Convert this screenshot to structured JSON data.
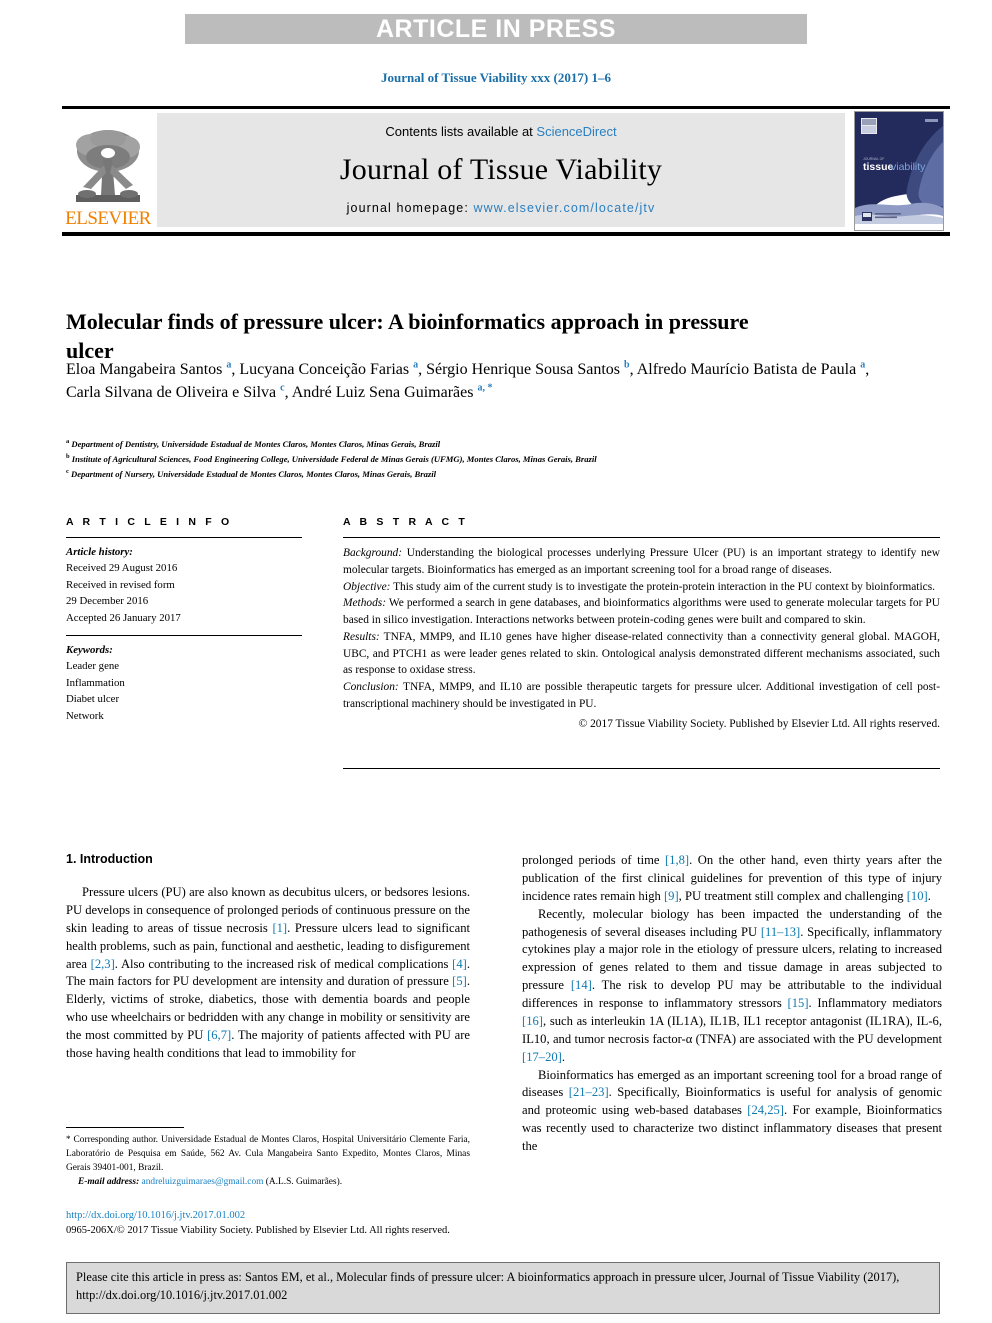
{
  "banner": {
    "text": "ARTICLE IN PRESS",
    "bg_color": "#bcbcbc",
    "text_color": "#ffffff"
  },
  "running_head": "Journal of Tissue Viability xxx (2017) 1–6",
  "masthead": {
    "publisher_logo_name": "elsevier-tree-logo",
    "publisher_wordmark": "ELSEVIER",
    "contents_prefix": "Contents lists available at ",
    "contents_link": "ScienceDirect",
    "journal_name": "Journal of Tissue Viability",
    "homepage_label": "journal homepage: ",
    "homepage_url": "www.elsevier.com/locate/jtv",
    "cover_title_a": "tissue",
    "cover_title_b": "viability",
    "accent_blue": "#2a7fc0",
    "elsevier_orange": "#f08000",
    "cover_navy": "#1f2352"
  },
  "article": {
    "title": "Molecular finds of pressure ulcer: A bioinformatics approach in pressure ulcer",
    "authors": [
      {
        "name": "Eloa Mangabeira Santos",
        "sup": "a",
        "sep": ", "
      },
      {
        "name": "Lucyana Conceição Farias",
        "sup": "a",
        "sep": ", "
      },
      {
        "name": "Sérgio Henrique Sousa Santos",
        "sup": "b",
        "sep": ", "
      },
      {
        "name": "Alfredo Maurício Batista de Paula",
        "sup": "a",
        "sep": ", "
      },
      {
        "name": "Carla Silvana de Oliveira e Silva",
        "sup": "c",
        "sep": ", "
      },
      {
        "name": "André Luiz Sena Guimarães",
        "sup": "a, *",
        "sep": ""
      }
    ],
    "affiliations": [
      {
        "mark": "a",
        "text": "Department of Dentistry, Universidade Estadual de Montes Claros, Montes Claros, Minas Gerais, Brazil"
      },
      {
        "mark": "b",
        "text": "Institute of Agricultural Sciences, Food Engineering College, Universidade Federal de Minas Gerais (UFMG), Montes Claros, Minas Gerais, Brazil"
      },
      {
        "mark": "c",
        "text": "Department of Nursery, Universidade Estadual de Montes Claros, Montes Claros, Minas Gerais, Brazil"
      }
    ]
  },
  "article_info": {
    "heading": "A R T I C L E   I N F O",
    "history_label": "Article history:",
    "history": [
      "Received 29 August 2016",
      "Received in revised form",
      "29 December 2016",
      "Accepted 26 January 2017"
    ],
    "keywords_label": "Keywords:",
    "keywords": [
      "Leader gene",
      "Inflammation",
      "Diabet ulcer",
      "Network"
    ]
  },
  "abstract": {
    "heading": "A B S T R A C T",
    "sections": [
      {
        "label": "Background:",
        "text": " Understanding the biological processes underlying Pressure Ulcer (PU) is an important strategy to identify new molecular targets. Bioinformatics has emerged as an important screening tool for a broad range of diseases."
      },
      {
        "label": "Objective:",
        "text": " This study aim of the current study is to investigate the protein-protein interaction in the PU context by bioinformatics."
      },
      {
        "label": "Methods:",
        "text": " We performed a search in gene databases, and bioinformatics algorithms were used to generate molecular targets for PU based in silico investigation. Interactions networks between protein-coding genes were built and compared to skin."
      },
      {
        "label": "Results:",
        "text": " TNFA, MMP9, and IL10 genes have higher disease-related connectivity than a connectivity general global. MAGOH, UBC, and PTCH1 as were leader genes related to skin. Ontological analysis demonstrated different mechanisms associated, such as response to oxidase stress."
      },
      {
        "label": "Conclusion:",
        "text": " TNFA, MMP9, and IL10 are possible therapeutic targets for pressure ulcer. Additional investigation of cell post-transcriptional machinery should be investigated in PU."
      }
    ],
    "copyright": "© 2017 Tissue Viability Society. Published by Elsevier Ltd. All rights reserved."
  },
  "body": {
    "section_number_title": "1. Introduction",
    "left_paragraphs": [
      {
        "parts": [
          {
            "t": "Pressure ulcers (PU) are also known as decubitus ulcers, or bedsores lesions. PU develops in consequence of prolonged periods of continuous pressure on the skin leading to areas of tissue necrosis ",
            "r": false
          },
          {
            "t": "[1]",
            "r": true
          },
          {
            "t": ". Pressure ulcers lead to significant health problems, such as pain, functional and aesthetic, leading to disfigurement area ",
            "r": false
          },
          {
            "t": "[2,3]",
            "r": true
          },
          {
            "t": ". Also contributing to the increased risk of medical complications ",
            "r": false
          },
          {
            "t": "[4]",
            "r": true
          },
          {
            "t": ". The main factors for PU development are intensity and duration of pressure ",
            "r": false
          },
          {
            "t": "[5]",
            "r": true
          },
          {
            "t": ". Elderly, victims of stroke, diabetics, those with dementia boards and people who use wheelchairs or bedridden with any change in mobility or sensitivity are the most committed by PU ",
            "r": false
          },
          {
            "t": "[6,7]",
            "r": true
          },
          {
            "t": ". The majority of patients affected with PU are those having health conditions that lead to immobility for",
            "r": false
          }
        ]
      }
    ],
    "right_paragraphs": [
      {
        "indent": false,
        "parts": [
          {
            "t": "prolonged periods of time ",
            "r": false
          },
          {
            "t": "[1,8]",
            "r": true
          },
          {
            "t": ". On the other hand, even thirty years after the publication of the first clinical guidelines for prevention of this type of injury incidence rates remain high ",
            "r": false
          },
          {
            "t": "[9]",
            "r": true
          },
          {
            "t": ", PU treatment still complex and challenging ",
            "r": false
          },
          {
            "t": "[10]",
            "r": true
          },
          {
            "t": ".",
            "r": false
          }
        ]
      },
      {
        "indent": true,
        "parts": [
          {
            "t": "Recently, molecular biology has been impacted the understanding of the pathogenesis of several diseases including PU ",
            "r": false
          },
          {
            "t": "[11–13]",
            "r": true
          },
          {
            "t": ". Specifically, inflammatory cytokines play a major role in the etiology of pressure ulcers, relating to increased expression of genes related to them and tissue damage in areas subjected to pressure ",
            "r": false
          },
          {
            "t": "[14]",
            "r": true
          },
          {
            "t": ". The risk to develop PU may be attributable to the individual differences in response to inflammatory stressors ",
            "r": false
          },
          {
            "t": "[15]",
            "r": true
          },
          {
            "t": ". Inflammatory mediators ",
            "r": false
          },
          {
            "t": "[16]",
            "r": true
          },
          {
            "t": ", such as interleukin 1A (IL1A), IL1B, IL1 receptor antagonist (IL1RA), IL-6, IL10, and tumor necrosis factor-α (TNFA) are associated with the PU development ",
            "r": false
          },
          {
            "t": "[17–20]",
            "r": true
          },
          {
            "t": ".",
            "r": false
          }
        ]
      },
      {
        "indent": true,
        "parts": [
          {
            "t": "Bioinformatics has emerged as an important screening tool for a broad range of diseases ",
            "r": false
          },
          {
            "t": "[21–23]",
            "r": true
          },
          {
            "t": ". Specifically, Bioinformatics is useful for analysis of genomic and proteomic using web-based databases ",
            "r": false
          },
          {
            "t": "[24,25]",
            "r": true
          },
          {
            "t": ". For example, Bioinformatics was recently used to characterize two distinct inflammatory diseases that present the",
            "r": false
          }
        ]
      }
    ]
  },
  "footnote": {
    "star": "*",
    "corresponding": " Corresponding author. Universidade Estadual de Montes Claros, Hospital Universitário Clemente Faria, Laboratório de Pesquisa em Saúde, 562 Av. Cula Mangabeira Santo Expedito, Montes Claros, Minas Gerais 39401-001, Brazil.",
    "email_label": "E-mail address:",
    "email": "andreluizguimaraes@gmail.com",
    "email_attrib": " (A.L.S. Guimarães)."
  },
  "doi_footer": {
    "doi_url": "http://dx.doi.org/10.1016/j.jtv.2017.01.002",
    "issn_line": "0965-206X/© 2017 Tissue Viability Society. Published by Elsevier Ltd. All rights reserved."
  },
  "citation_box": {
    "text": "Please cite this article in press as: Santos EM, et al., Molecular finds of pressure ulcer: A bioinformatics approach in pressure ulcer, Journal of Tissue Viability (2017), http://dx.doi.org/10.1016/j.jtv.2017.01.002"
  }
}
